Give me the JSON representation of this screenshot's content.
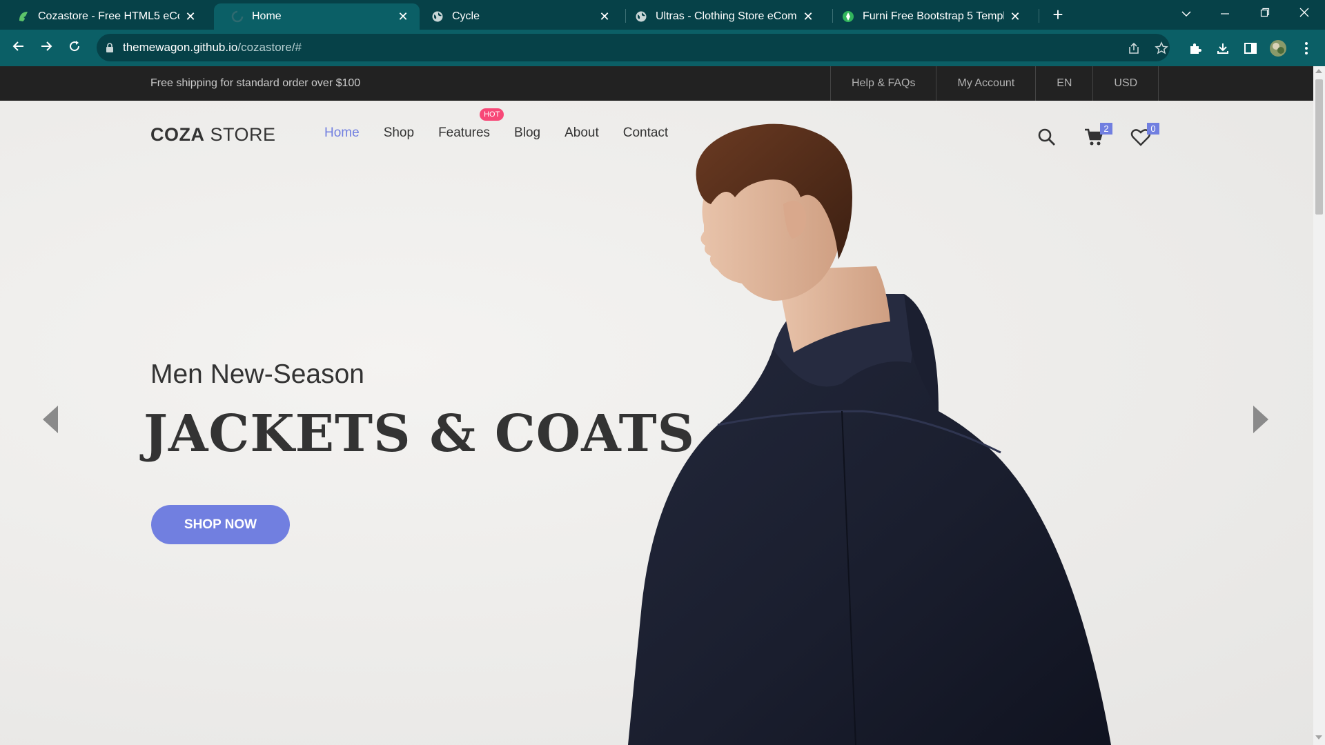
{
  "browser": {
    "tabs": [
      {
        "title": "Cozastore - Free HTML5 eComm",
        "active": false,
        "icon": "cozastore-favicon"
      },
      {
        "title": "Home",
        "active": true,
        "icon": "loading-icon"
      },
      {
        "title": "Cycle",
        "active": false,
        "icon": "globe-icon"
      },
      {
        "title": "Ultras - Clothing Store eCommerc",
        "active": false,
        "icon": "globe-icon"
      },
      {
        "title": "Furni Free Bootstrap 5 Template f",
        "active": false,
        "icon": "furni-favicon"
      }
    ],
    "url_host": "themewagon.github.io",
    "url_path": "/cozastore/#",
    "colors": {
      "tabbar": "#064148",
      "toolbar": "#0b5f66"
    }
  },
  "topbar": {
    "shipping_text": "Free shipping for standard order over $100",
    "links": [
      "Help & FAQs",
      "My Account",
      "EN",
      "USD"
    ]
  },
  "header": {
    "logo_bold": "COZA",
    "logo_light": " STORE",
    "menu": [
      {
        "label": "Home",
        "active": true
      },
      {
        "label": "Shop",
        "active": false
      },
      {
        "label": "Features",
        "active": false,
        "badge": "HOT"
      },
      {
        "label": "Blog",
        "active": false
      },
      {
        "label": "About",
        "active": false
      },
      {
        "label": "Contact",
        "active": false
      }
    ],
    "cart_count": "2",
    "wishlist_count": "0",
    "accent": "#717fe0",
    "hot_color": "#f74877"
  },
  "hero": {
    "subtitle": "Men New-Season",
    "title": "JACKETS & COATS",
    "cta": "SHOP NOW"
  }
}
